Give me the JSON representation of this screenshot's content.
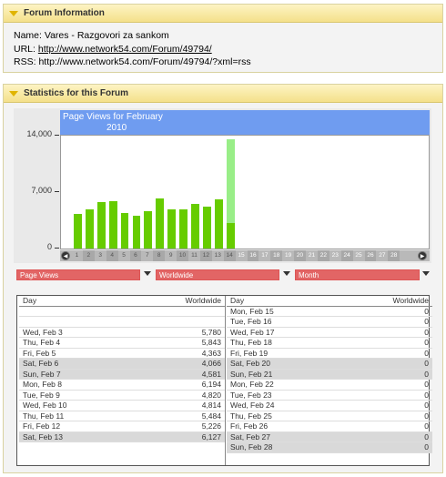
{
  "forum_info": {
    "header": "Forum Information",
    "name_label": "Name:",
    "name": "Vares - Razgovori za sankom",
    "url_label": "URL:",
    "url": "http://www.network54.com/Forum/49794/",
    "rss_label": "RSS:",
    "rss": "http://www.network54.com/Forum/49794/?xml=rss"
  },
  "stats": {
    "header": "Statistics for this Forum",
    "selects": {
      "metric": "Page Views",
      "region": "Worldwide",
      "period": "Month"
    },
    "table": {
      "col_day": "Day",
      "col_region": "Worldwide",
      "left_rows": [
        {
          "day": "",
          "value": "",
          "gray": false
        },
        {
          "day": "",
          "value": "",
          "gray": false
        },
        {
          "day": "Wed, Feb 3",
          "value": "5,780",
          "gray": false
        },
        {
          "day": "Thu, Feb 4",
          "value": "5,843",
          "gray": false
        },
        {
          "day": "Fri, Feb 5",
          "value": "4,363",
          "gray": false
        },
        {
          "day": "Sat, Feb 6",
          "value": "4,066",
          "gray": true
        },
        {
          "day": "Sun, Feb 7",
          "value": "4,581",
          "gray": true
        },
        {
          "day": "Mon, Feb 8",
          "value": "6,194",
          "gray": false
        },
        {
          "day": "Tue, Feb 9",
          "value": "4,820",
          "gray": false
        },
        {
          "day": "Wed, Feb 10",
          "value": "4,814",
          "gray": false
        },
        {
          "day": "Thu, Feb 11",
          "value": "5,484",
          "gray": false
        },
        {
          "day": "Fri, Feb 12",
          "value": "5,226",
          "gray": false
        },
        {
          "day": "Sat, Feb 13",
          "value": "6,127",
          "gray": true
        }
      ],
      "right_rows": [
        {
          "day": "Mon, Feb 15",
          "value": "0",
          "gray": false
        },
        {
          "day": "Tue, Feb 16",
          "value": "0",
          "gray": false
        },
        {
          "day": "Wed, Feb 17",
          "value": "0",
          "gray": false
        },
        {
          "day": "Thu, Feb 18",
          "value": "0",
          "gray": false
        },
        {
          "day": "Fri, Feb 19",
          "value": "0",
          "gray": false
        },
        {
          "day": "Sat, Feb 20",
          "value": "0",
          "gray": true
        },
        {
          "day": "Sun, Feb 21",
          "value": "0",
          "gray": true
        },
        {
          "day": "Mon, Feb 22",
          "value": "0",
          "gray": false
        },
        {
          "day": "Tue, Feb 23",
          "value": "0",
          "gray": false
        },
        {
          "day": "Wed, Feb 24",
          "value": "0",
          "gray": false
        },
        {
          "day": "Thu, Feb 25",
          "value": "0",
          "gray": false
        },
        {
          "day": "Fri, Feb 26",
          "value": "0",
          "gray": false
        },
        {
          "day": "Sat, Feb 27",
          "value": "0",
          "gray": true
        },
        {
          "day": "Sun, Feb 28",
          "value": "0",
          "gray": true
        }
      ]
    }
  },
  "chart_data": {
    "type": "bar",
    "title": "Page Views for February 2010",
    "title_line1": "Page Views for February",
    "title_line2": "2010",
    "ylim": [
      0,
      14000
    ],
    "yticks": [
      "14,000",
      "7,000",
      "0"
    ],
    "ytick_values": [
      14000,
      7000,
      0
    ],
    "categories": [
      "1",
      "2",
      "3",
      "4",
      "5",
      "6",
      "7",
      "8",
      "9",
      "10",
      "11",
      "12",
      "13",
      "14",
      "15",
      "16",
      "17",
      "18",
      "19",
      "20",
      "21",
      "22",
      "23",
      "24",
      "25",
      "26",
      "27",
      "28"
    ],
    "series": [
      {
        "values": [
          4300,
          4900,
          5780,
          5843,
          4363,
          4066,
          4581,
          6194,
          4820,
          4814,
          5484,
          5226,
          6127,
          3200,
          0,
          0,
          0,
          0,
          0,
          0,
          0,
          0,
          0,
          0,
          0,
          0,
          0,
          0
        ]
      }
    ],
    "projected": {
      "category": "14",
      "value": 13500
    },
    "colors": {
      "bar": "#66cc00",
      "projected": "#99ee88",
      "title_bg": "#6f9cf0"
    },
    "nav": {
      "prev_icon": "prev-icon",
      "next_icon": "next-icon"
    }
  }
}
